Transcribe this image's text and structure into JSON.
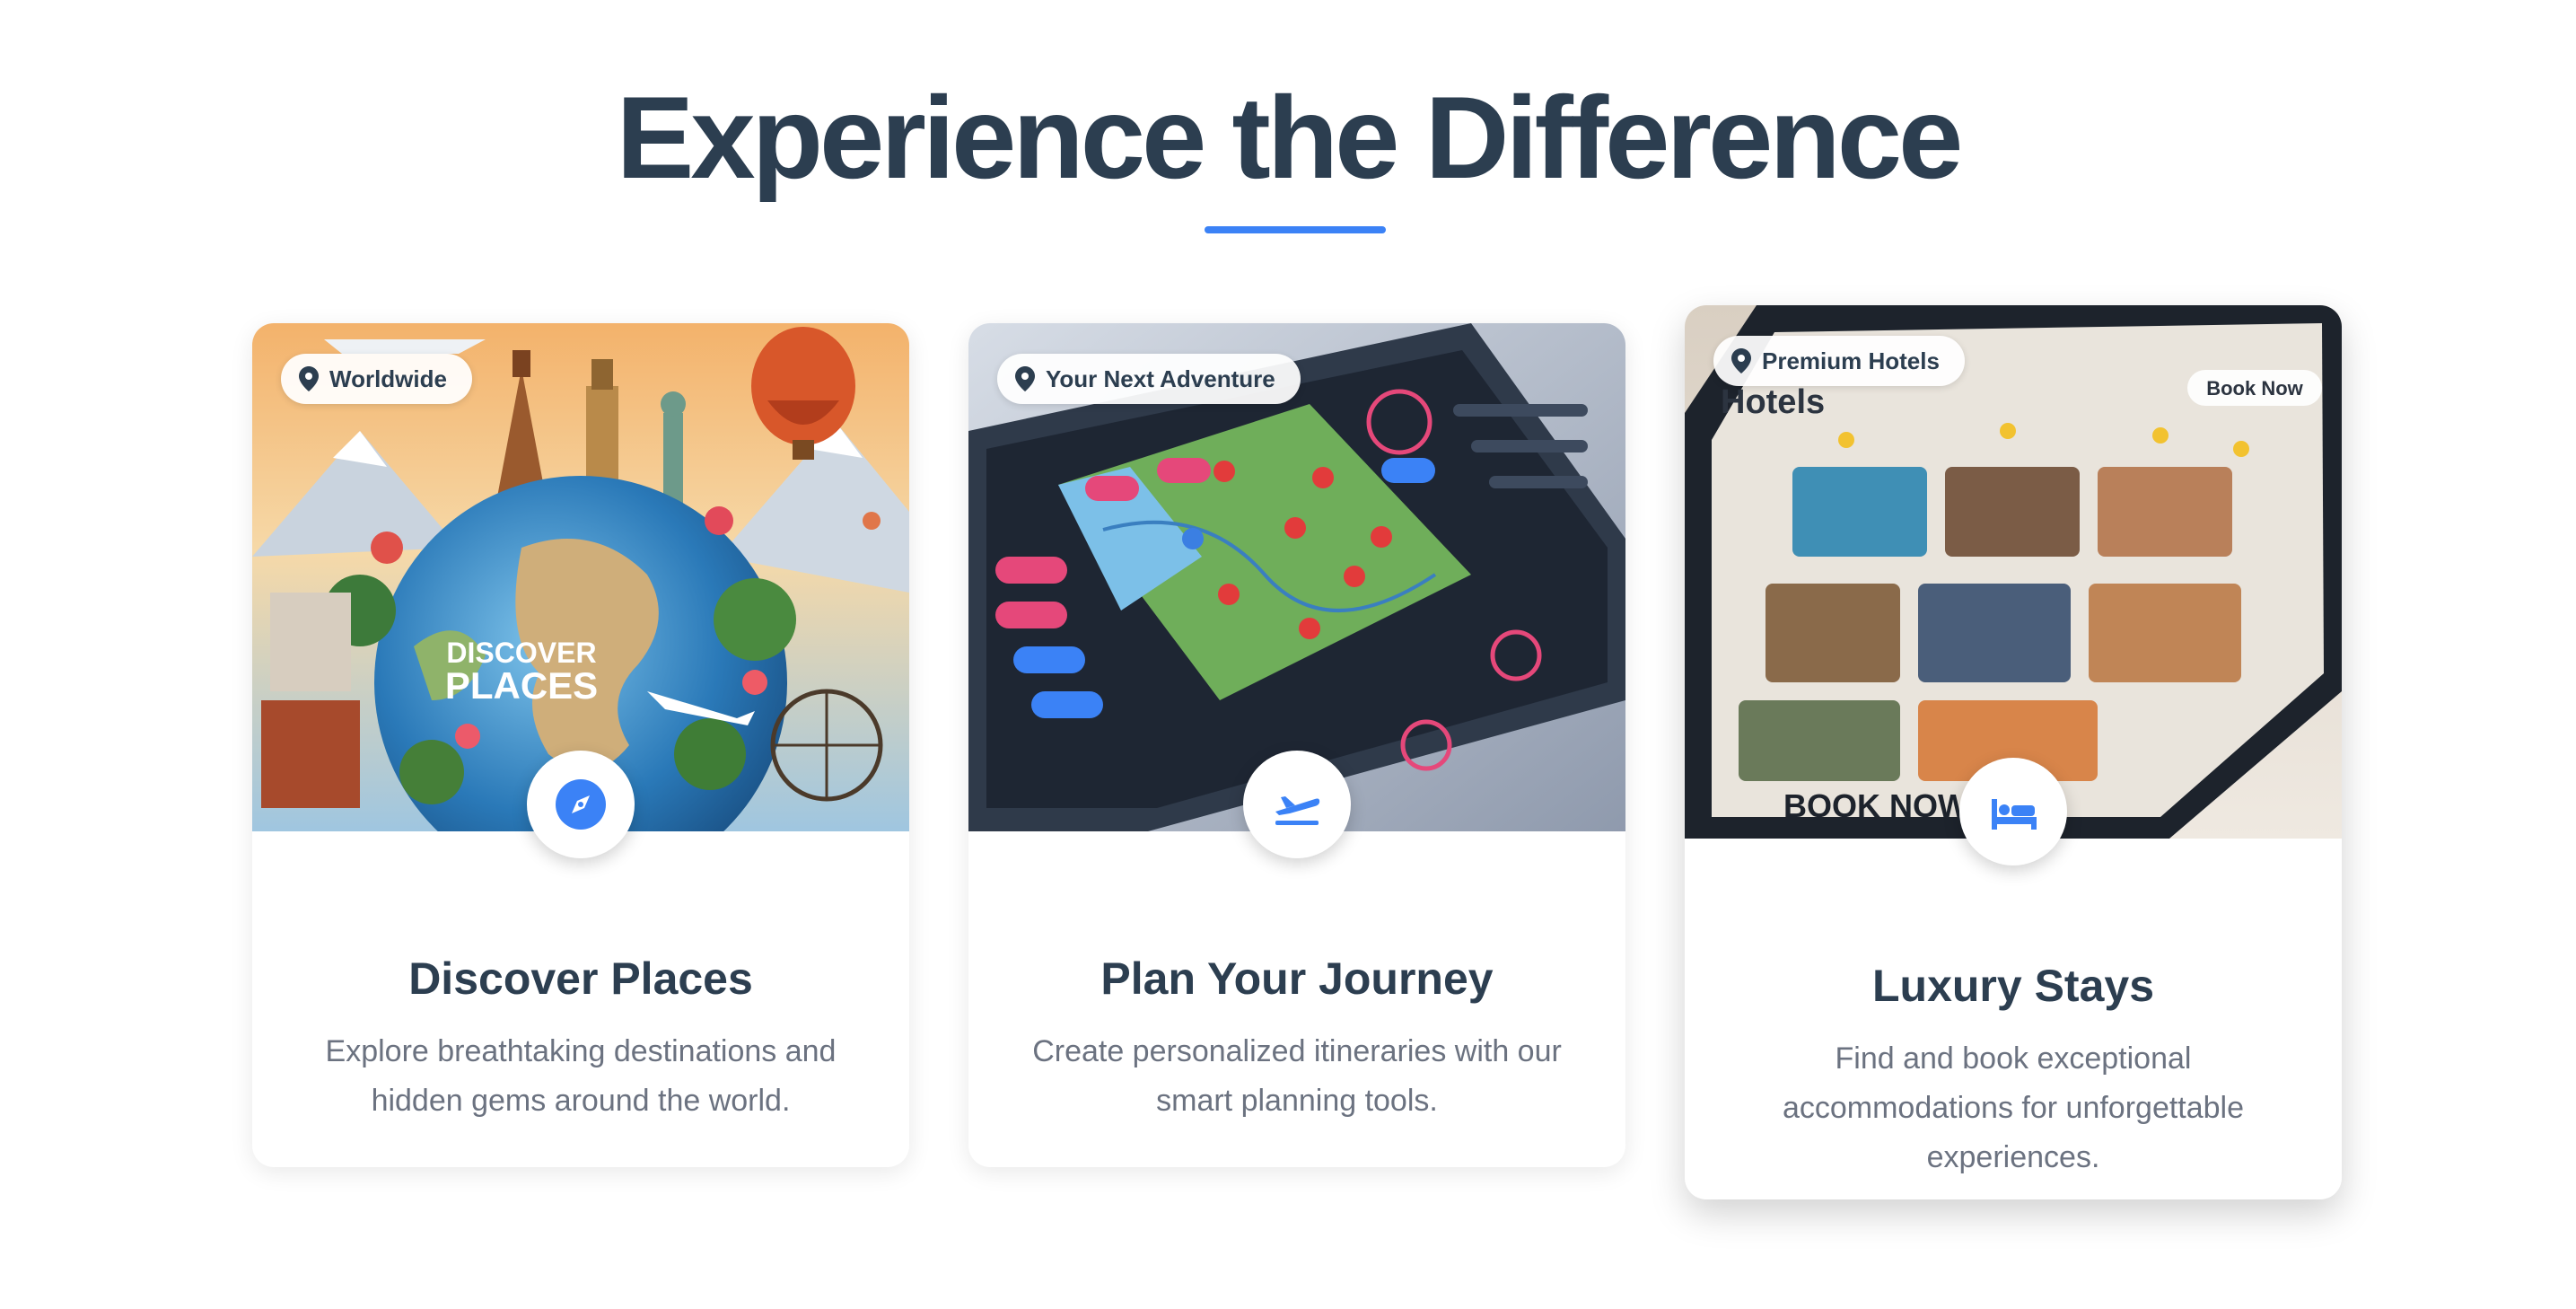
{
  "section": {
    "title": "Experience the Difference",
    "accent_color": "#3b82f6"
  },
  "cards": [
    {
      "badge": "Worldwide",
      "badge_icon": "map-pin-icon",
      "feature_icon": "compass-icon",
      "title": "Discover Places",
      "description": "Explore breathtaking destinations and hidden gems around the world.",
      "image_text": [
        "DISCOVER",
        "PLACES"
      ]
    },
    {
      "badge": "Your Next Adventure",
      "badge_icon": "map-pin-icon",
      "feature_icon": "airplane-departure-icon",
      "title": "Plan Your Journey",
      "description": "Create personalized itineraries with our smart planning tools."
    },
    {
      "badge": "Premium Hotels",
      "badge_icon": "map-pin-icon",
      "feature_icon": "bed-icon",
      "title": "Luxury Stays",
      "description": "Find and book exceptional accommodations for unforgettable experiences.",
      "image_text": [
        "Hotels",
        "Book Now",
        "BOOK NOW"
      ]
    }
  ]
}
